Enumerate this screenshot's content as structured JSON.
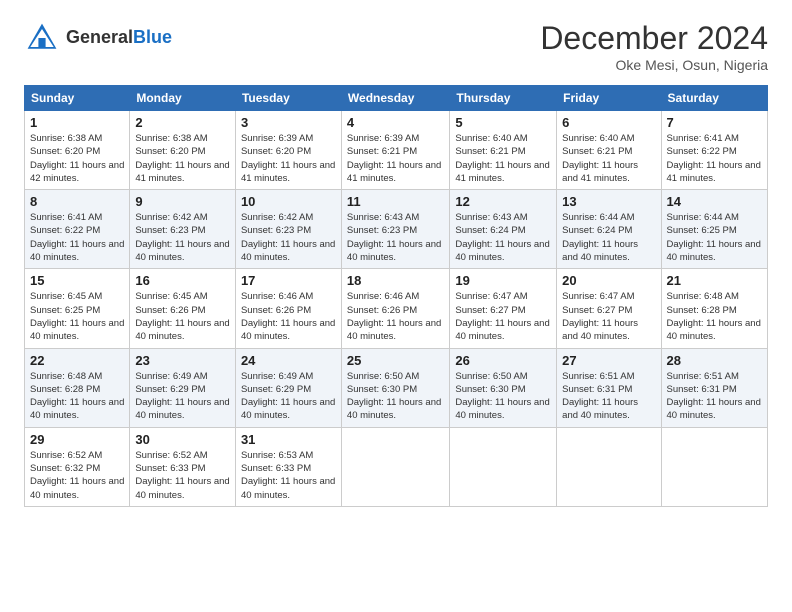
{
  "header": {
    "logo_general": "General",
    "logo_blue": "Blue",
    "month_title": "December 2024",
    "location": "Oke Mesi, Osun, Nigeria"
  },
  "columns": [
    "Sunday",
    "Monday",
    "Tuesday",
    "Wednesday",
    "Thursday",
    "Friday",
    "Saturday"
  ],
  "weeks": [
    [
      {
        "day": "1",
        "sunrise": "6:38 AM",
        "sunset": "6:20 PM",
        "daylight": "11 hours and 42 minutes."
      },
      {
        "day": "2",
        "sunrise": "6:38 AM",
        "sunset": "6:20 PM",
        "daylight": "11 hours and 41 minutes."
      },
      {
        "day": "3",
        "sunrise": "6:39 AM",
        "sunset": "6:20 PM",
        "daylight": "11 hours and 41 minutes."
      },
      {
        "day": "4",
        "sunrise": "6:39 AM",
        "sunset": "6:21 PM",
        "daylight": "11 hours and 41 minutes."
      },
      {
        "day": "5",
        "sunrise": "6:40 AM",
        "sunset": "6:21 PM",
        "daylight": "11 hours and 41 minutes."
      },
      {
        "day": "6",
        "sunrise": "6:40 AM",
        "sunset": "6:21 PM",
        "daylight": "11 hours and 41 minutes."
      },
      {
        "day": "7",
        "sunrise": "6:41 AM",
        "sunset": "6:22 PM",
        "daylight": "11 hours and 41 minutes."
      }
    ],
    [
      {
        "day": "8",
        "sunrise": "6:41 AM",
        "sunset": "6:22 PM",
        "daylight": "11 hours and 40 minutes."
      },
      {
        "day": "9",
        "sunrise": "6:42 AM",
        "sunset": "6:23 PM",
        "daylight": "11 hours and 40 minutes."
      },
      {
        "day": "10",
        "sunrise": "6:42 AM",
        "sunset": "6:23 PM",
        "daylight": "11 hours and 40 minutes."
      },
      {
        "day": "11",
        "sunrise": "6:43 AM",
        "sunset": "6:23 PM",
        "daylight": "11 hours and 40 minutes."
      },
      {
        "day": "12",
        "sunrise": "6:43 AM",
        "sunset": "6:24 PM",
        "daylight": "11 hours and 40 minutes."
      },
      {
        "day": "13",
        "sunrise": "6:44 AM",
        "sunset": "6:24 PM",
        "daylight": "11 hours and 40 minutes."
      },
      {
        "day": "14",
        "sunrise": "6:44 AM",
        "sunset": "6:25 PM",
        "daylight": "11 hours and 40 minutes."
      }
    ],
    [
      {
        "day": "15",
        "sunrise": "6:45 AM",
        "sunset": "6:25 PM",
        "daylight": "11 hours and 40 minutes."
      },
      {
        "day": "16",
        "sunrise": "6:45 AM",
        "sunset": "6:26 PM",
        "daylight": "11 hours and 40 minutes."
      },
      {
        "day": "17",
        "sunrise": "6:46 AM",
        "sunset": "6:26 PM",
        "daylight": "11 hours and 40 minutes."
      },
      {
        "day": "18",
        "sunrise": "6:46 AM",
        "sunset": "6:26 PM",
        "daylight": "11 hours and 40 minutes."
      },
      {
        "day": "19",
        "sunrise": "6:47 AM",
        "sunset": "6:27 PM",
        "daylight": "11 hours and 40 minutes."
      },
      {
        "day": "20",
        "sunrise": "6:47 AM",
        "sunset": "6:27 PM",
        "daylight": "11 hours and 40 minutes."
      },
      {
        "day": "21",
        "sunrise": "6:48 AM",
        "sunset": "6:28 PM",
        "daylight": "11 hours and 40 minutes."
      }
    ],
    [
      {
        "day": "22",
        "sunrise": "6:48 AM",
        "sunset": "6:28 PM",
        "daylight": "11 hours and 40 minutes."
      },
      {
        "day": "23",
        "sunrise": "6:49 AM",
        "sunset": "6:29 PM",
        "daylight": "11 hours and 40 minutes."
      },
      {
        "day": "24",
        "sunrise": "6:49 AM",
        "sunset": "6:29 PM",
        "daylight": "11 hours and 40 minutes."
      },
      {
        "day": "25",
        "sunrise": "6:50 AM",
        "sunset": "6:30 PM",
        "daylight": "11 hours and 40 minutes."
      },
      {
        "day": "26",
        "sunrise": "6:50 AM",
        "sunset": "6:30 PM",
        "daylight": "11 hours and 40 minutes."
      },
      {
        "day": "27",
        "sunrise": "6:51 AM",
        "sunset": "6:31 PM",
        "daylight": "11 hours and 40 minutes."
      },
      {
        "day": "28",
        "sunrise": "6:51 AM",
        "sunset": "6:31 PM",
        "daylight": "11 hours and 40 minutes."
      }
    ],
    [
      {
        "day": "29",
        "sunrise": "6:52 AM",
        "sunset": "6:32 PM",
        "daylight": "11 hours and 40 minutes."
      },
      {
        "day": "30",
        "sunrise": "6:52 AM",
        "sunset": "6:33 PM",
        "daylight": "11 hours and 40 minutes."
      },
      {
        "day": "31",
        "sunrise": "6:53 AM",
        "sunset": "6:33 PM",
        "daylight": "11 hours and 40 minutes."
      },
      null,
      null,
      null,
      null
    ]
  ]
}
